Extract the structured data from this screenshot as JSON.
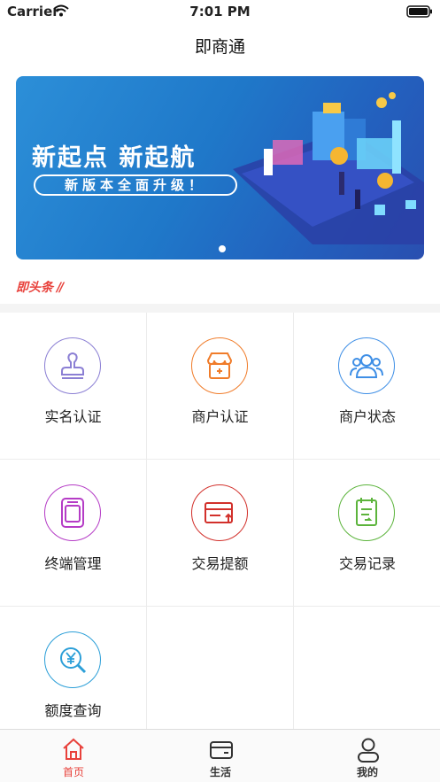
{
  "status_bar": {
    "carrier": "Carrier",
    "time": "7:01 PM"
  },
  "nav": {
    "title": "即商通"
  },
  "banner": {
    "headline": "新起点 新起航",
    "subline": "新版本全面升级！"
  },
  "news": {
    "label": "即头条"
  },
  "grid": [
    {
      "label": "实名认证",
      "icon": "stamp-icon",
      "color": "#8b7fd4"
    },
    {
      "label": "商户认证",
      "icon": "shop-icon",
      "color": "#f07c2a"
    },
    {
      "label": "商户状态",
      "icon": "users-icon",
      "color": "#3f8fe6"
    },
    {
      "label": "终端管理",
      "icon": "terminal-icon",
      "color": "#b53cc6"
    },
    {
      "label": "交易提额",
      "icon": "card-upgrade-icon",
      "color": "#d2302b"
    },
    {
      "label": "交易记录",
      "icon": "record-icon",
      "color": "#5cb43c"
    },
    {
      "label": "额度查询",
      "icon": "quota-search-icon",
      "color": "#2c9fd8"
    }
  ],
  "tabs": [
    {
      "label": "首页",
      "icon": "home-icon",
      "active": true
    },
    {
      "label": "生活",
      "icon": "wallet-icon",
      "active": false
    },
    {
      "label": "我的",
      "icon": "profile-icon",
      "active": false
    }
  ],
  "colors": {
    "accent": "#e8413b",
    "banner": "#1f78c9"
  }
}
